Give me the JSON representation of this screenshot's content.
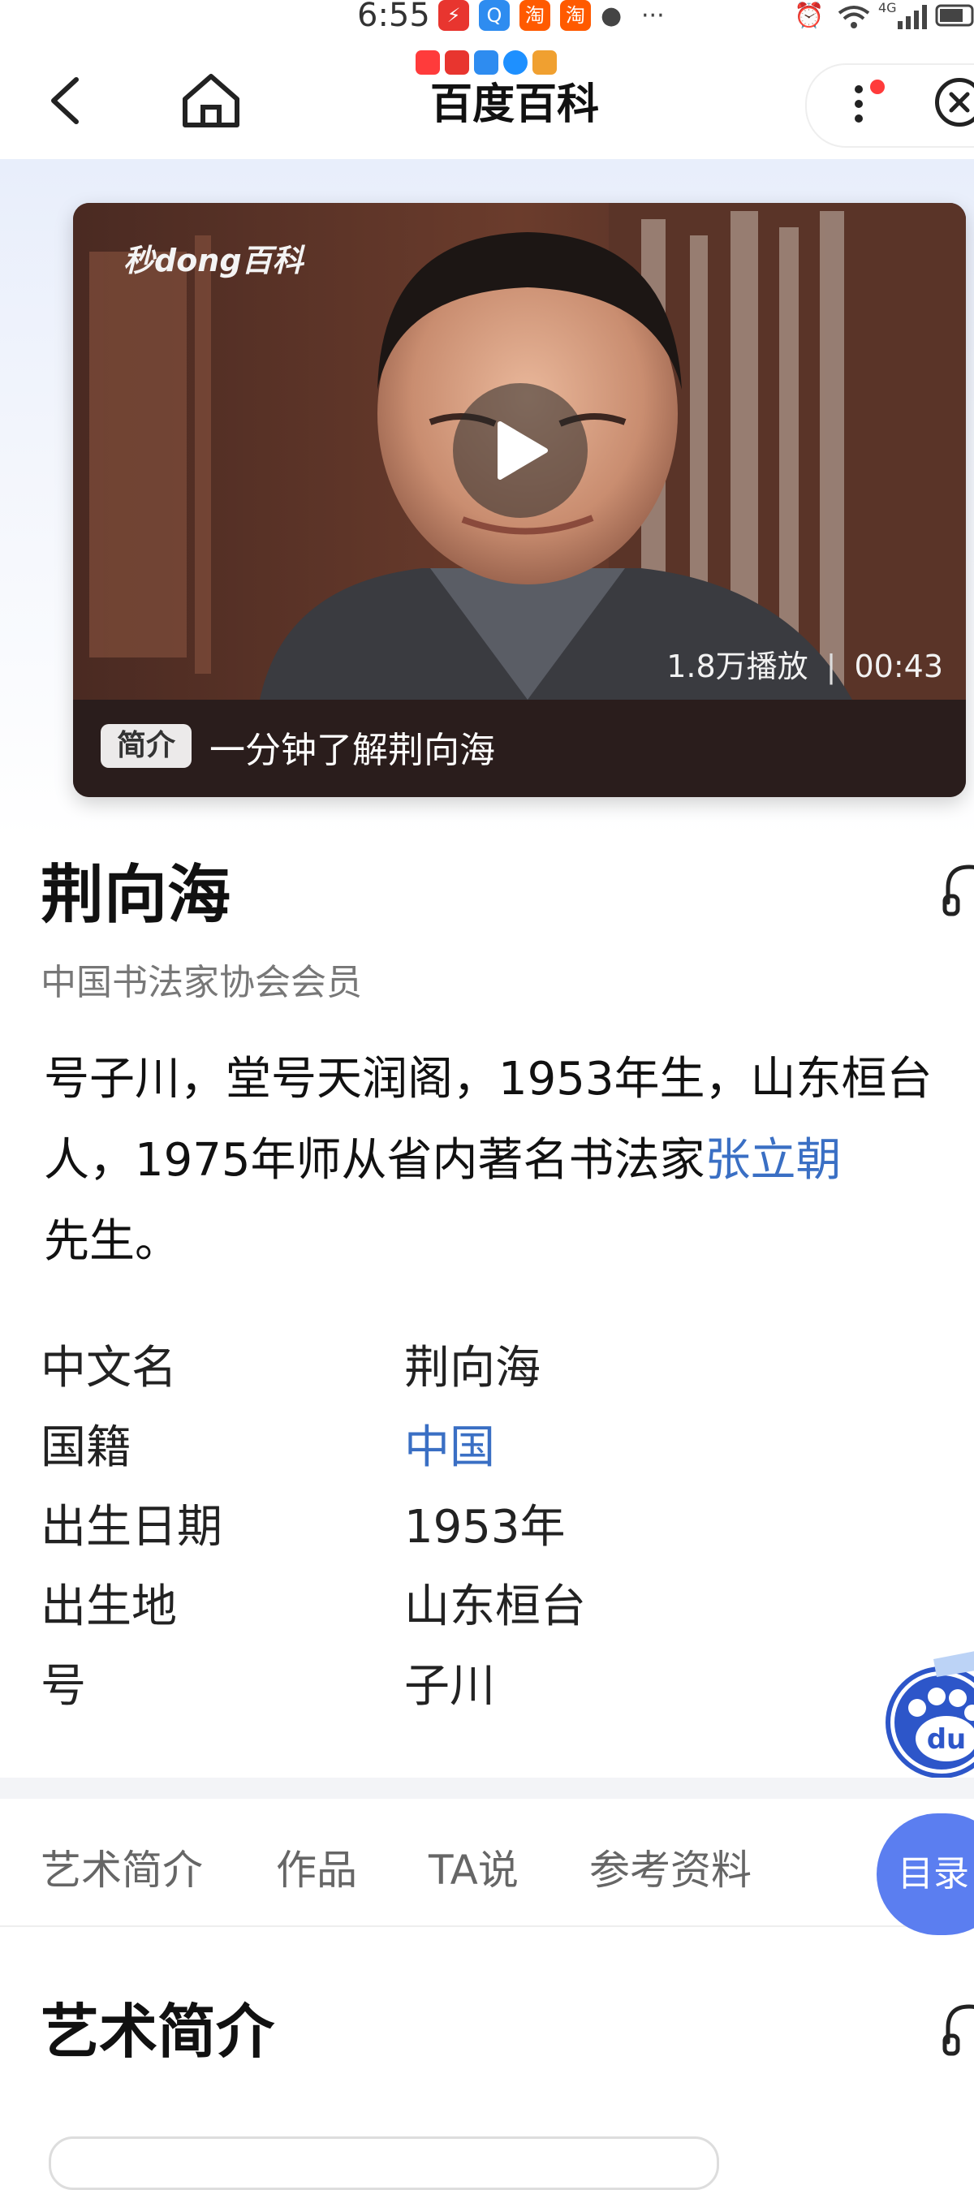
{
  "status_bar": {
    "time": "6:55",
    "app_icons": [
      {
        "name": "app-icon-1",
        "glyph": "⚡",
        "color": "#e8352f"
      },
      {
        "name": "app-icon-2",
        "glyph": "Q",
        "color": "#2e8cf0"
      },
      {
        "name": "taobao-icon",
        "glyph": "淘",
        "color": "#ff5a00"
      },
      {
        "name": "taobao-icon-2",
        "glyph": "淘",
        "color": "#ff5a00"
      },
      {
        "name": "message-icon",
        "glyph": "💬",
        "color": "#555555"
      }
    ],
    "more_indicator": "···",
    "network": "4G"
  },
  "nav": {
    "title": "百度百科",
    "mini_app_colors": [
      "#ff3b3b",
      "#e8352f",
      "#2e8cf0",
      "#1e90ff",
      "#f0a030"
    ]
  },
  "video": {
    "brand": "秒dong百科",
    "plays": "1.8万播放",
    "duration": "00:43",
    "badge": "简介",
    "caption": "一分钟了解荆向海"
  },
  "entry": {
    "title": "荆向海",
    "subtitle": "中国书法家协会会员",
    "summary_part1": "号子川，堂号天润阁，1953年生，山东桓台人，1975年师从省内著名书法家",
    "summary_link": "张立朝",
    "summary_part2": "先生。"
  },
  "infobox": [
    {
      "label": "中文名",
      "value": "荆向海",
      "link": false
    },
    {
      "label": "国籍",
      "value": "中国",
      "link": true
    },
    {
      "label": "出生日期",
      "value": "1953年",
      "link": false
    },
    {
      "label": "出生地",
      "value": "山东桓台",
      "link": false
    },
    {
      "label": "号",
      "value": "子川",
      "link": false
    }
  ],
  "tabs": [
    "艺术简介",
    "作品",
    "TA说",
    "参考资料"
  ],
  "toc_label": "目录",
  "section": {
    "title": "艺术简介"
  },
  "colors": {
    "link": "#3a6fc4",
    "toc_button": "#5b7ef0",
    "accent_red": "#ff3b3b"
  }
}
